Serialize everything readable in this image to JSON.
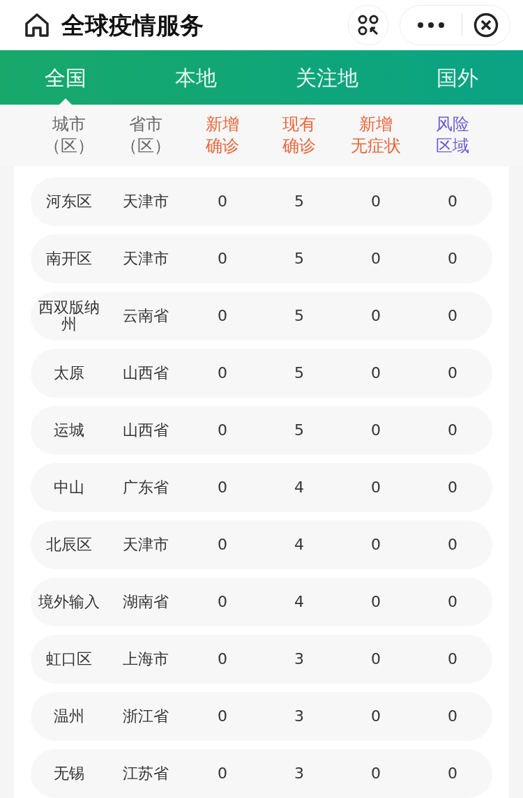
{
  "window": {
    "title": "全球疫情服务"
  },
  "tabs": [
    {
      "label": "全国",
      "selected": true
    },
    {
      "label": "本地",
      "selected": false
    },
    {
      "label": "关注地",
      "selected": false
    },
    {
      "label": "国外",
      "selected": false
    }
  ],
  "table": {
    "columns": [
      {
        "label": "城市（区）",
        "color": "#666666"
      },
      {
        "label": "省市（区）",
        "color": "#666666"
      },
      {
        "label": "新增确诊",
        "color": "#e8663a"
      },
      {
        "label": "现有确诊",
        "color": "#e8663a"
      },
      {
        "label": "新增无症状",
        "color": "#e8663a"
      },
      {
        "label": "风险区域",
        "color": "#6b5bd6"
      }
    ],
    "rows": [
      [
        "河东区",
        "天津市",
        "0",
        "5",
        "0",
        "0"
      ],
      [
        "南开区",
        "天津市",
        "0",
        "5",
        "0",
        "0"
      ],
      [
        "西双版纳州",
        "云南省",
        "0",
        "5",
        "0",
        "0"
      ],
      [
        "太原",
        "山西省",
        "0",
        "5",
        "0",
        "0"
      ],
      [
        "运城",
        "山西省",
        "0",
        "5",
        "0",
        "0"
      ],
      [
        "中山",
        "广东省",
        "0",
        "4",
        "0",
        "0"
      ],
      [
        "北辰区",
        "天津市",
        "0",
        "4",
        "0",
        "0"
      ],
      [
        "境外输入",
        "湖南省",
        "0",
        "4",
        "0",
        "0"
      ],
      [
        "虹口区",
        "上海市",
        "0",
        "3",
        "0",
        "0"
      ],
      [
        "温州",
        "浙江省",
        "0",
        "3",
        "0",
        "0"
      ],
      [
        "无锡",
        "江苏省",
        "0",
        "3",
        "0",
        "0"
      ]
    ]
  }
}
